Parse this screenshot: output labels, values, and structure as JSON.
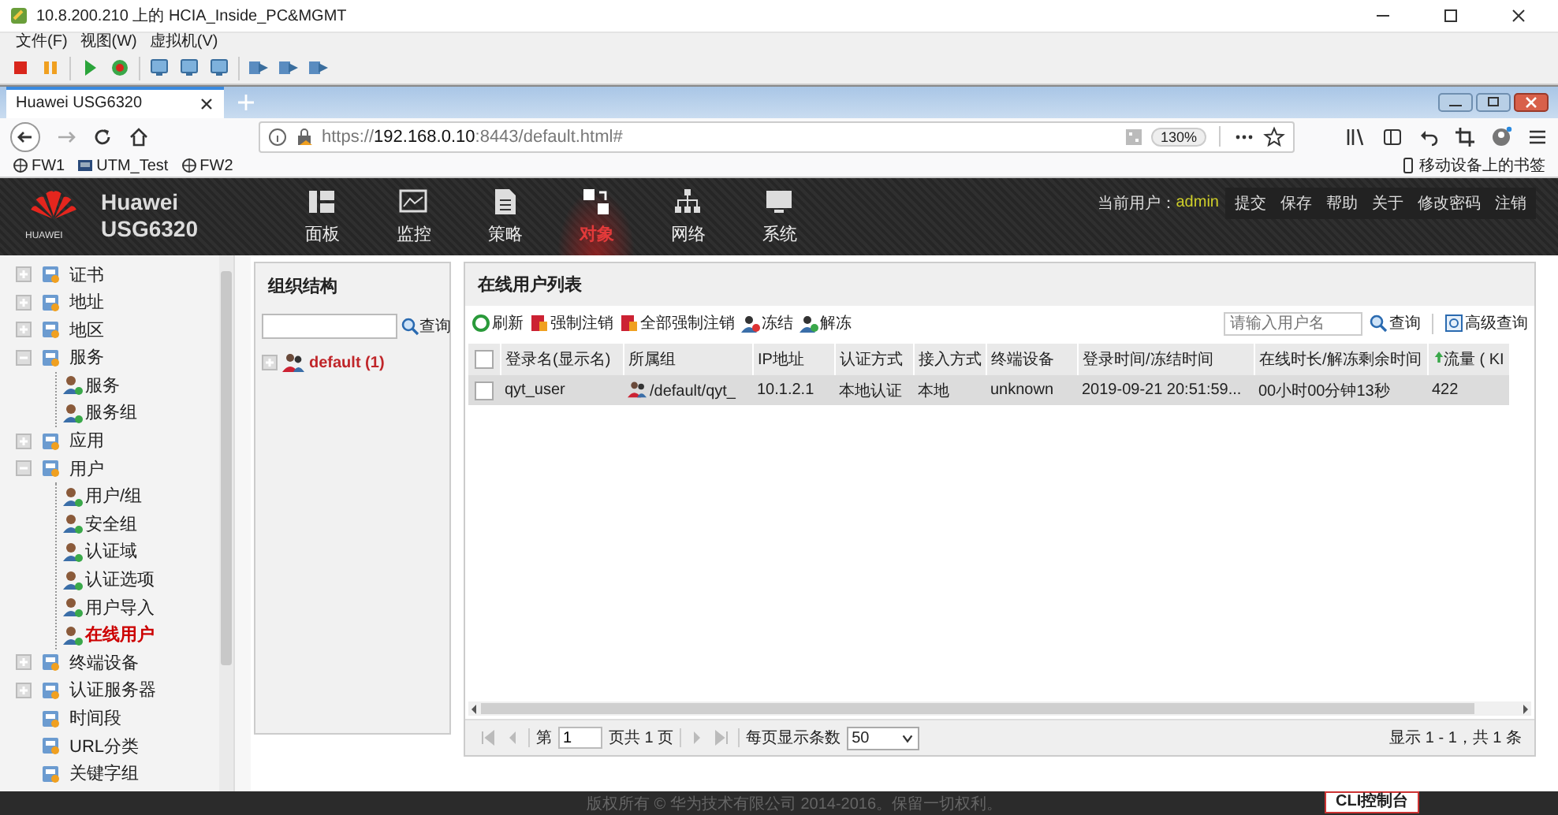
{
  "vm_window": {
    "title": "10.8.200.210 上的 HCIA_Inside_PC&MGMT",
    "menu": [
      "文件(F)",
      "视图(W)",
      "虚拟机(V)"
    ]
  },
  "browser": {
    "tab": {
      "label": "Huawei USG6320",
      "selected": true
    },
    "url_scheme": "https://",
    "url_host": "192.168.0.10",
    "url_rest": ":8443/default.html#",
    "zoom": "130%",
    "bookmarks": [
      "FW1",
      "UTM_Test",
      "FW2"
    ],
    "mobile_bookmarks": "移动设备上的书签"
  },
  "app": {
    "brand": "Huawei",
    "model": "USG6320",
    "logo_text": "HUAWEI",
    "nav": [
      {
        "label": "面板",
        "selected": false
      },
      {
        "label": "监控",
        "selected": false
      },
      {
        "label": "策略",
        "selected": false
      },
      {
        "label": "对象",
        "selected": true
      },
      {
        "label": "网络",
        "selected": false
      },
      {
        "label": "系统",
        "selected": false
      }
    ],
    "current_user_label": "当前用户：",
    "current_user": "admin",
    "actions": [
      "提交",
      "保存",
      "帮助",
      "关于",
      "修改密码",
      "注销"
    ]
  },
  "sidebar": {
    "items": [
      {
        "label": "证书",
        "expanded": false,
        "selected": false
      },
      {
        "label": "地址",
        "expanded": false,
        "selected": false
      },
      {
        "label": "地区",
        "expanded": false,
        "selected": false
      },
      {
        "label": "服务",
        "expanded": true,
        "selected": false,
        "children": [
          {
            "label": "服务",
            "selected": false
          },
          {
            "label": "服务组",
            "selected": false
          }
        ]
      },
      {
        "label": "应用",
        "expanded": false,
        "selected": false
      },
      {
        "label": "用户",
        "expanded": true,
        "selected": false,
        "children": [
          {
            "label": "用户/组",
            "selected": false
          },
          {
            "label": "安全组",
            "selected": false
          },
          {
            "label": "认证域",
            "selected": false
          },
          {
            "label": "认证选项",
            "selected": false
          },
          {
            "label": "用户导入",
            "selected": false
          },
          {
            "label": "在线用户",
            "selected": true
          }
        ]
      },
      {
        "label": "终端设备",
        "expanded": false,
        "selected": false
      },
      {
        "label": "认证服务器",
        "expanded": false,
        "selected": false
      },
      {
        "label": "时间段",
        "selected": false
      },
      {
        "label": "URL分类",
        "selected": false
      },
      {
        "label": "关键字组",
        "selected": false
      }
    ]
  },
  "org_panel": {
    "title": "组织结构",
    "search_button": "查询",
    "tree": [
      {
        "label": "default (1)",
        "expanded": false
      }
    ]
  },
  "online_users": {
    "title": "在线用户列表",
    "toolbar": [
      "刷新",
      "强制注销",
      "全部强制注销",
      "冻结",
      "解冻"
    ],
    "search_placeholder": "请输入用户名",
    "search_button": "查询",
    "advanced_button": "高级查询",
    "select_all_checked": false,
    "columns": [
      "登录名(显示名)",
      "所属组",
      "IP地址",
      "认证方式",
      "接入方式",
      "终端设备",
      "登录时间/冻结时间",
      "在线时长/解冻剩余时间",
      "流量 ( KI"
    ],
    "rows": [
      {
        "checked": false,
        "selected": true,
        "cells": [
          "qyt_user",
          "/default/qyt_",
          "10.1.2.1",
          "本地认证",
          "本地",
          "unknown",
          "2019-09-21 20:51:59...",
          "00小时00分钟13秒",
          "422"
        ]
      }
    ],
    "pager": {
      "page_prefix": "第",
      "page": "1",
      "page_suffix": "页共 1 页",
      "per_page_label": "每页显示条数",
      "per_page": "50",
      "summary": "显示 1 - 1，共 1 条"
    }
  },
  "footer": {
    "copyright": "版权所有 © 华为技术有限公司 2014-2016。保留一切权利。",
    "cli_button": "CLI控制台"
  }
}
